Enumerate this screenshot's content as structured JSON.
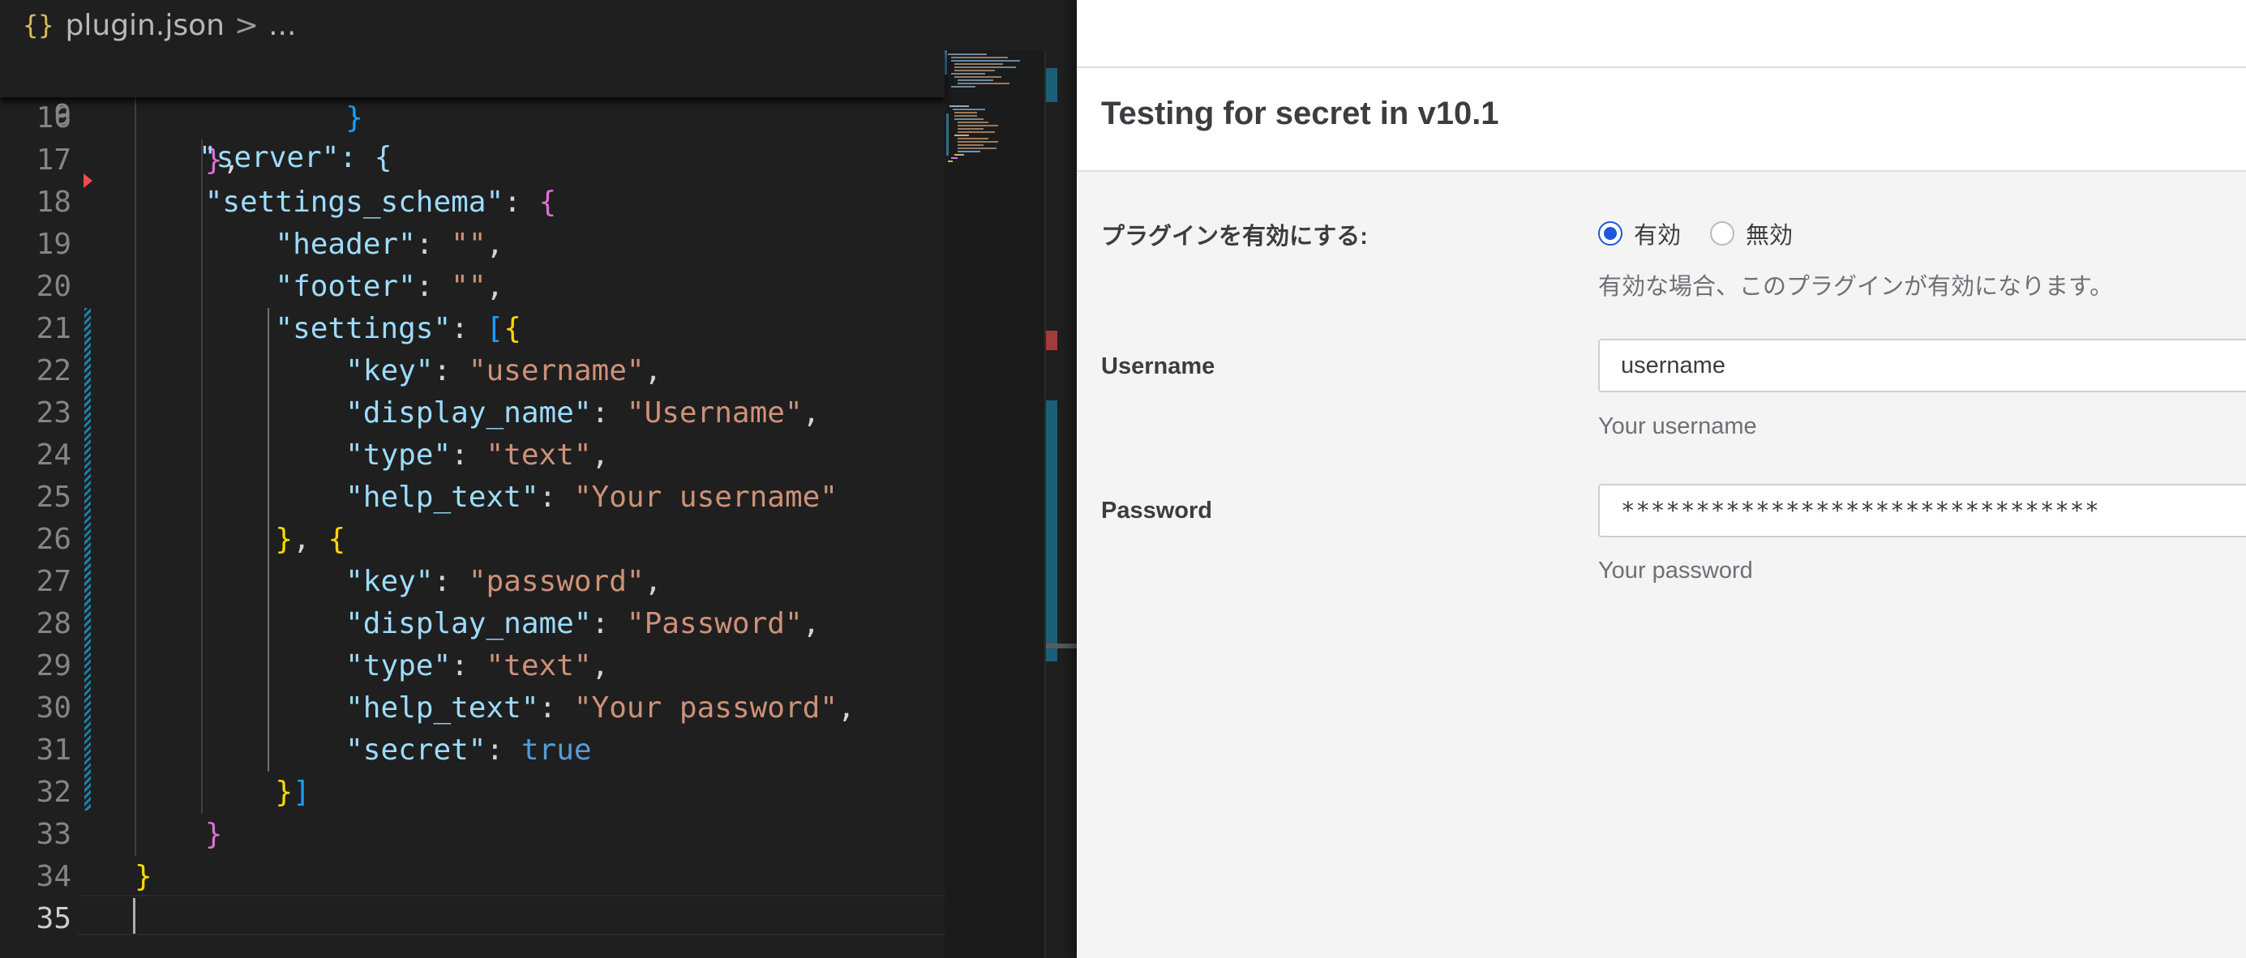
{
  "editor": {
    "breadcrumb": {
      "icon": "{}",
      "file": "plugin.json",
      "separator": ">",
      "rest": "..."
    },
    "sticky": {
      "number": "9",
      "text": "\"server\": {"
    },
    "lines": [
      {
        "number": "16",
        "tokens": [
          {
            "t": "            ",
            "c": "p"
          },
          {
            "t": "}",
            "c": "br3"
          }
        ]
      },
      {
        "number": "17",
        "tokens": [
          {
            "t": "    ",
            "c": "p"
          },
          {
            "t": "}",
            "c": "br2"
          },
          {
            "t": ",",
            "c": "p"
          }
        ]
      },
      {
        "number": "18",
        "tokens": [
          {
            "t": "    ",
            "c": "p"
          },
          {
            "t": "\"settings_schema\"",
            "c": "k"
          },
          {
            "t": ": ",
            "c": "p"
          },
          {
            "t": "{",
            "c": "br2"
          }
        ]
      },
      {
        "number": "19",
        "tokens": [
          {
            "t": "        ",
            "c": "p"
          },
          {
            "t": "\"header\"",
            "c": "k"
          },
          {
            "t": ": ",
            "c": "p"
          },
          {
            "t": "\"\"",
            "c": "s"
          },
          {
            "t": ",",
            "c": "p"
          }
        ]
      },
      {
        "number": "20",
        "tokens": [
          {
            "t": "        ",
            "c": "p"
          },
          {
            "t": "\"footer\"",
            "c": "k"
          },
          {
            "t": ": ",
            "c": "p"
          },
          {
            "t": "\"\"",
            "c": "s"
          },
          {
            "t": ",",
            "c": "p"
          }
        ]
      },
      {
        "number": "21",
        "tokens": [
          {
            "t": "        ",
            "c": "p"
          },
          {
            "t": "\"settings\"",
            "c": "k"
          },
          {
            "t": ": ",
            "c": "p"
          },
          {
            "t": "[",
            "c": "br3"
          },
          {
            "t": "{",
            "c": "br1"
          }
        ]
      },
      {
        "number": "22",
        "tokens": [
          {
            "t": "            ",
            "c": "p"
          },
          {
            "t": "\"key\"",
            "c": "k"
          },
          {
            "t": ": ",
            "c": "p"
          },
          {
            "t": "\"username\"",
            "c": "s"
          },
          {
            "t": ",",
            "c": "p"
          }
        ]
      },
      {
        "number": "23",
        "tokens": [
          {
            "t": "            ",
            "c": "p"
          },
          {
            "t": "\"display_name\"",
            "c": "k"
          },
          {
            "t": ": ",
            "c": "p"
          },
          {
            "t": "\"Username\"",
            "c": "s"
          },
          {
            "t": ",",
            "c": "p"
          }
        ]
      },
      {
        "number": "24",
        "tokens": [
          {
            "t": "            ",
            "c": "p"
          },
          {
            "t": "\"type\"",
            "c": "k"
          },
          {
            "t": ": ",
            "c": "p"
          },
          {
            "t": "\"text\"",
            "c": "s"
          },
          {
            "t": ",",
            "c": "p"
          }
        ]
      },
      {
        "number": "25",
        "tokens": [
          {
            "t": "            ",
            "c": "p"
          },
          {
            "t": "\"help_text\"",
            "c": "k"
          },
          {
            "t": ": ",
            "c": "p"
          },
          {
            "t": "\"Your username\"",
            "c": "s"
          }
        ]
      },
      {
        "number": "26",
        "tokens": [
          {
            "t": "        ",
            "c": "p"
          },
          {
            "t": "}",
            "c": "br1"
          },
          {
            "t": ", ",
            "c": "p"
          },
          {
            "t": "{",
            "c": "br1"
          }
        ]
      },
      {
        "number": "27",
        "tokens": [
          {
            "t": "            ",
            "c": "p"
          },
          {
            "t": "\"key\"",
            "c": "k"
          },
          {
            "t": ": ",
            "c": "p"
          },
          {
            "t": "\"password\"",
            "c": "s"
          },
          {
            "t": ",",
            "c": "p"
          }
        ]
      },
      {
        "number": "28",
        "tokens": [
          {
            "t": "            ",
            "c": "p"
          },
          {
            "t": "\"display_name\"",
            "c": "k"
          },
          {
            "t": ": ",
            "c": "p"
          },
          {
            "t": "\"Password\"",
            "c": "s"
          },
          {
            "t": ",",
            "c": "p"
          }
        ]
      },
      {
        "number": "29",
        "tokens": [
          {
            "t": "            ",
            "c": "p"
          },
          {
            "t": "\"type\"",
            "c": "k"
          },
          {
            "t": ": ",
            "c": "p"
          },
          {
            "t": "\"text\"",
            "c": "s"
          },
          {
            "t": ",",
            "c": "p"
          }
        ]
      },
      {
        "number": "30",
        "tokens": [
          {
            "t": "            ",
            "c": "p"
          },
          {
            "t": "\"help_text\"",
            "c": "k"
          },
          {
            "t": ": ",
            "c": "p"
          },
          {
            "t": "\"Your password\"",
            "c": "s"
          },
          {
            "t": ",",
            "c": "p"
          }
        ]
      },
      {
        "number": "31",
        "tokens": [
          {
            "t": "            ",
            "c": "p"
          },
          {
            "t": "\"secret\"",
            "c": "k"
          },
          {
            "t": ": ",
            "c": "p"
          },
          {
            "t": "true",
            "c": "b"
          }
        ]
      },
      {
        "number": "32",
        "tokens": [
          {
            "t": "        ",
            "c": "p"
          },
          {
            "t": "}",
            "c": "br1"
          },
          {
            "t": "]",
            "c": "br3"
          }
        ]
      },
      {
        "number": "33",
        "tokens": [
          {
            "t": "    ",
            "c": "p"
          },
          {
            "t": "}",
            "c": "br2"
          }
        ]
      },
      {
        "number": "34",
        "tokens": [
          {
            "t": "}",
            "c": "br1"
          }
        ]
      },
      {
        "number": "35",
        "tokens": []
      }
    ]
  },
  "panel": {
    "title": "Testing for secret in v10.1",
    "enable": {
      "label": "プラグインを有効にする:",
      "options": [
        {
          "label": "有効",
          "checked": true
        },
        {
          "label": "無効",
          "checked": false
        }
      ],
      "help": "有効な場合、このプラグインが有効になります。"
    },
    "username": {
      "label": "Username",
      "value": "username",
      "help": "Your username"
    },
    "password": {
      "label": "Password",
      "value": "********************************",
      "help": "Your password"
    }
  }
}
